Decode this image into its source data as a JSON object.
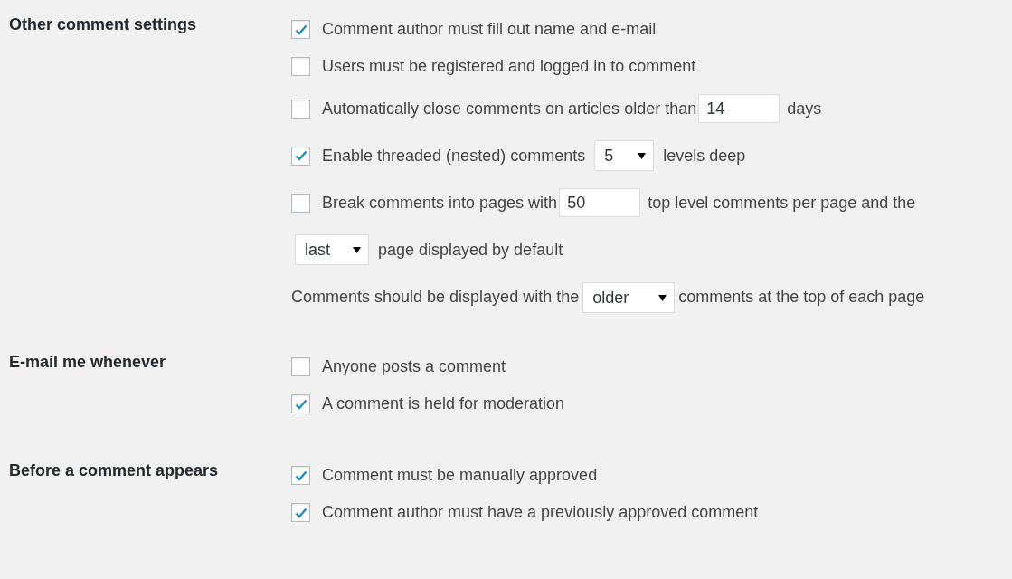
{
  "sections": [
    {
      "label": "Other comment settings",
      "rows": [
        {
          "kind": "check",
          "checked": true,
          "parts": [
            {
              "kind": "text",
              "text": "Comment author must fill out name and e-mail"
            }
          ]
        },
        {
          "kind": "check",
          "checked": false,
          "parts": [
            {
              "kind": "text",
              "text": "Users must be registered and logged in to comment"
            }
          ]
        },
        {
          "kind": "check",
          "checked": false,
          "parts": [
            {
              "kind": "text",
              "text": "Automatically close comments on articles older than"
            },
            {
              "kind": "input",
              "value": "14"
            },
            {
              "kind": "text",
              "text": "days"
            }
          ]
        },
        {
          "kind": "check",
          "checked": true,
          "parts": [
            {
              "kind": "text",
              "text": "Enable threaded (nested) comments"
            },
            {
              "kind": "select",
              "value": "5"
            },
            {
              "kind": "text",
              "text": "levels deep"
            }
          ]
        },
        {
          "kind": "check",
          "checked": false,
          "parts": [
            {
              "kind": "text",
              "text": "Break comments into pages with"
            },
            {
              "kind": "input",
              "value": "50"
            },
            {
              "kind": "text",
              "text": "top level comments per page and the"
            }
          ]
        },
        {
          "kind": "plain",
          "parts": [
            {
              "kind": "select",
              "value": "last"
            },
            {
              "kind": "text",
              "text": "page displayed by default"
            }
          ]
        },
        {
          "kind": "para",
          "parts": [
            {
              "kind": "text",
              "text": "Comments should be displayed with the"
            },
            {
              "kind": "select",
              "value": "older"
            },
            {
              "kind": "text",
              "text": "comments at the top of each page"
            }
          ]
        }
      ]
    },
    {
      "label": "E-mail me whenever",
      "rows": [
        {
          "kind": "check",
          "checked": false,
          "parts": [
            {
              "kind": "text",
              "text": "Anyone posts a comment"
            }
          ]
        },
        {
          "kind": "check",
          "checked": true,
          "parts": [
            {
              "kind": "text",
              "text": "A comment is held for moderation"
            }
          ]
        }
      ]
    },
    {
      "label": "Before a comment appears",
      "rows": [
        {
          "kind": "check",
          "checked": true,
          "parts": [
            {
              "kind": "text",
              "text": "Comment must be manually approved"
            }
          ]
        },
        {
          "kind": "check",
          "checked": true,
          "parts": [
            {
              "kind": "text",
              "text": "Comment author must have a previously approved comment"
            }
          ]
        }
      ]
    }
  ]
}
